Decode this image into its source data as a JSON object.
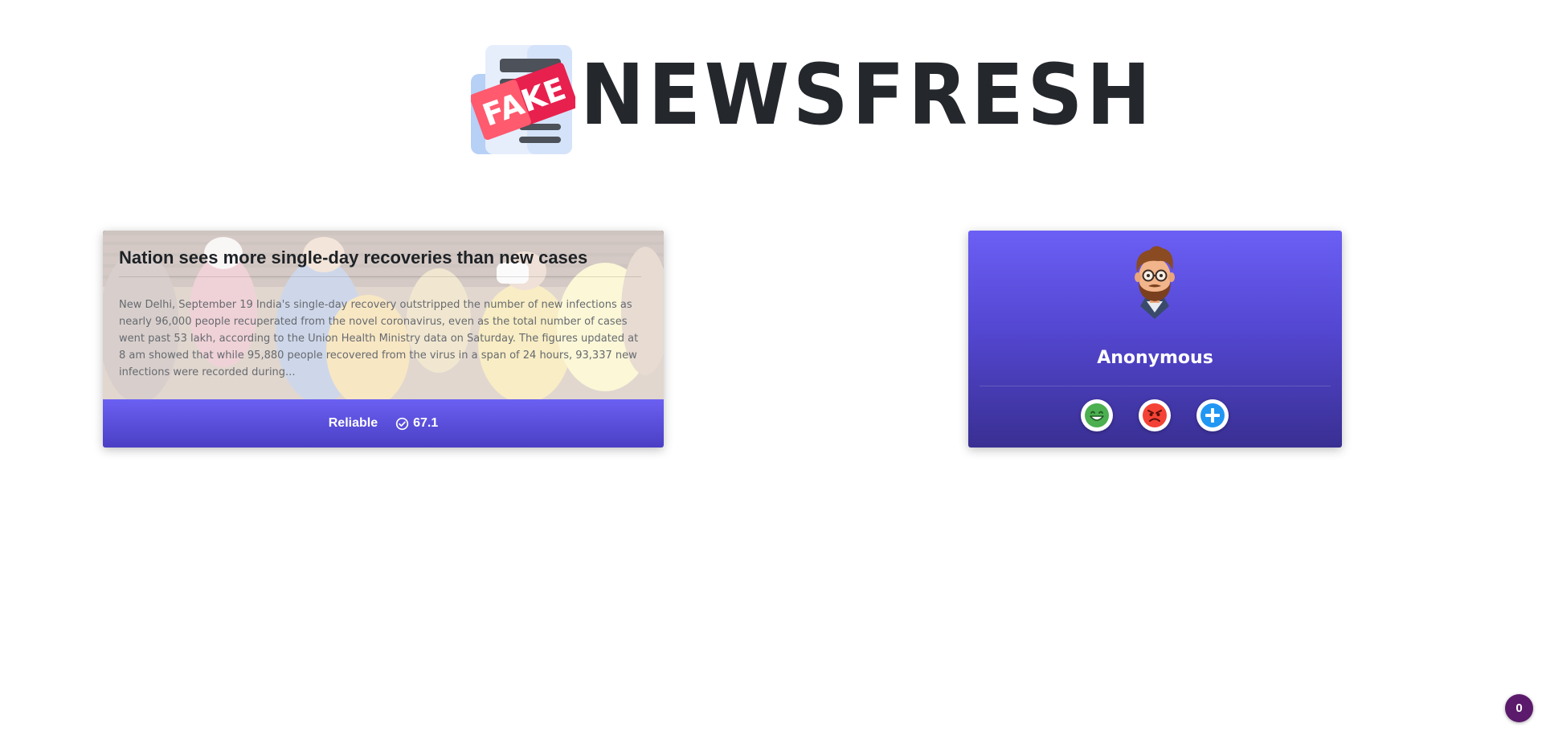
{
  "header": {
    "logo_badge_text": "FAKE",
    "brand_name": "NEWSFRESH"
  },
  "news_card": {
    "title": "Nation sees more single-day recoveries than new cases",
    "excerpt": "New Delhi, September 19 India's single-day recovery outstripped the number of new infections as nearly 96,000 people recuperated from the novel coronavirus, even as the total number of cases went past 53 lakh, according to the Union Health Ministry data on Saturday. The figures updated at 8 am showed that while 95,880 people recovered from the virus in a span of 24 hours, 93,337 new infections were recorded during...",
    "verdict": "Reliable",
    "score": "67.1"
  },
  "profile_card": {
    "name": "Anonymous",
    "reactions": [
      {
        "name": "happy-face-icon",
        "color": "#4caf50"
      },
      {
        "name": "angry-face-icon",
        "color": "#f44336"
      },
      {
        "name": "plus-icon",
        "color": "#2196f3"
      }
    ]
  },
  "notification_badge": {
    "count": "0",
    "color": "#5b1a6b"
  },
  "colors": {
    "accent": "#6b60f2",
    "accent_dark": "#392f92",
    "logo_fake_label": "#e8204e",
    "brand_text": "#24272c"
  }
}
